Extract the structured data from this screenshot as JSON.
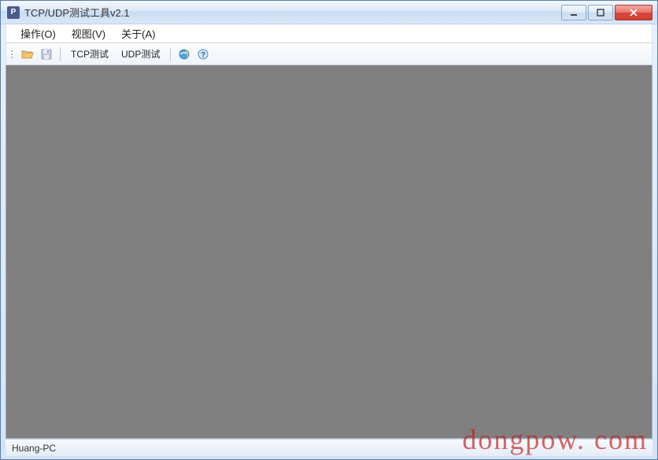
{
  "window": {
    "title": "TCP/UDP测试工具v2.1",
    "app_icon_glyph": "P"
  },
  "menubar": {
    "items": [
      {
        "label": "操作(O)"
      },
      {
        "label": "视图(V)"
      },
      {
        "label": "关于(A)"
      }
    ]
  },
  "toolbar": {
    "open_icon": "folder-open-icon",
    "save_icon": "save-icon",
    "tcp_test_label": "TCP测试",
    "udp_test_label": "UDP测试",
    "ie_icon": "internet-explorer-icon",
    "help_icon": "help-icon"
  },
  "statusbar": {
    "text": "Huang-PC"
  },
  "watermark": "dongpow. com"
}
